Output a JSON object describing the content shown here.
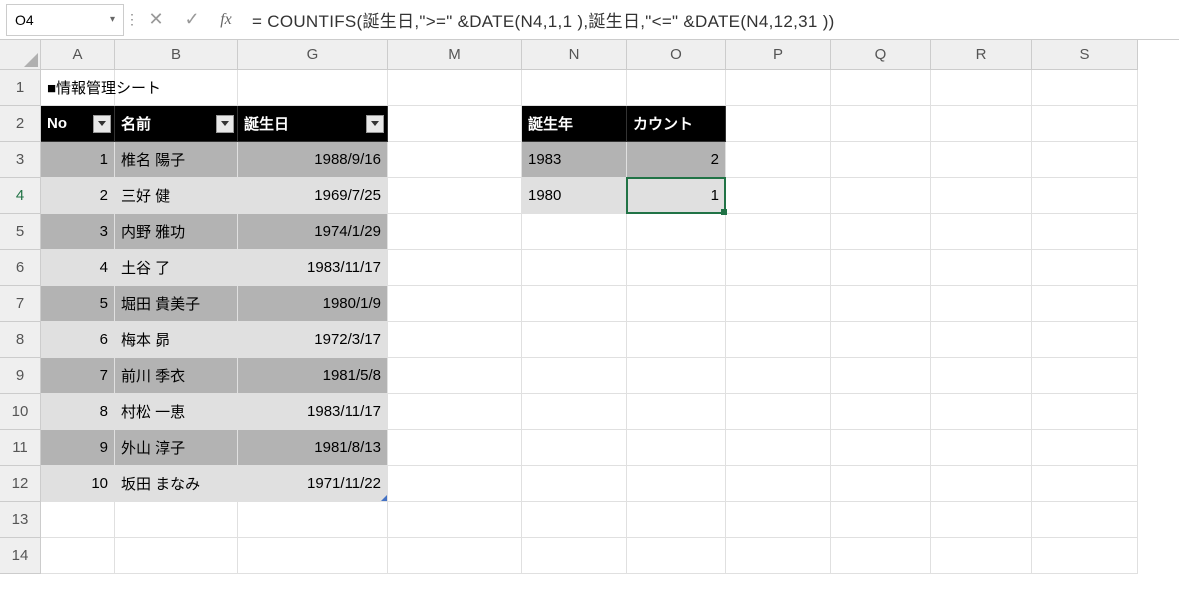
{
  "nameBox": "O4",
  "formula": "= COUNTIFS(誕生日,\">=\" &DATE(N4,1,1 ),誕生日,\"<=\" &DATE(N4,12,31 ))",
  "colHeaders": [
    "A",
    "B",
    "G",
    "M",
    "N",
    "O",
    "P",
    "Q",
    "R",
    "S"
  ],
  "rowHeaders": [
    "1",
    "2",
    "3",
    "4",
    "5",
    "6",
    "7",
    "8",
    "9",
    "10",
    "11",
    "12",
    "13",
    "14"
  ],
  "activeRow": "4",
  "title": "■情報管理シート",
  "tableHeaders": {
    "no": "No",
    "name": "名前",
    "birth": "誕生日"
  },
  "lookupHeaders": {
    "year": "誕生年",
    "count": "カウント"
  },
  "rows": [
    {
      "no": "1",
      "name": "椎名 陽子",
      "birth": "1988/9/16",
      "shade": "dk"
    },
    {
      "no": "2",
      "name": "三好 健",
      "birth": "1969/7/25",
      "shade": "lt"
    },
    {
      "no": "3",
      "name": "内野 雅功",
      "birth": "1974/1/29",
      "shade": "dk"
    },
    {
      "no": "4",
      "name": "土谷 了",
      "birth": "1983/11/17",
      "shade": "lt"
    },
    {
      "no": "5",
      "name": "堀田 貴美子",
      "birth": "1980/1/9",
      "shade": "dk"
    },
    {
      "no": "6",
      "name": "梅本 昴",
      "birth": "1972/3/17",
      "shade": "lt"
    },
    {
      "no": "7",
      "name": "前川 季衣",
      "birth": "1981/5/8",
      "shade": "dk"
    },
    {
      "no": "8",
      "name": "村松 一恵",
      "birth": "1983/11/17",
      "shade": "lt"
    },
    {
      "no": "9",
      "name": "外山 淳子",
      "birth": "1981/8/13",
      "shade": "dk"
    },
    {
      "no": "10",
      "name": "坂田 まなみ",
      "birth": "1971/11/22",
      "shade": "lt"
    }
  ],
  "lookup": [
    {
      "year": "1983",
      "count": "2",
      "shade": "dk"
    },
    {
      "year": "1980",
      "count": "1",
      "shade": "lt"
    }
  ]
}
